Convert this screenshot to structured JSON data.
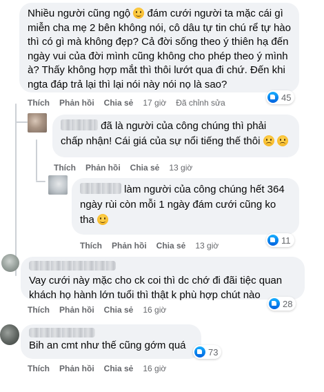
{
  "comments": [
    {
      "text_parts": [
        "Nhiều người cũng ngộ ",
        " đám cưới người ta mặc cái gì miễn cha mẹ 2 bên không nói, cô dâu tự tin chú rể tự hào thì có gì mà không đẹp? Cả đời sống theo ý thiên hạ đến ngày vui của đời mình cũng không cho phép theo ý mình à? Thấy không hợp mắt thì thôi lướt qua đi chứ. Đến khi ngta đáp trả lại thì lại nói này nói nọ là sao?"
      ],
      "actions": {
        "like": "Thích",
        "reply": "Phản hồi",
        "share": "Chia sẻ",
        "time": "17 giờ",
        "edited": "Đã chỉnh sửa"
      },
      "reaction_count": "45"
    },
    {
      "text_parts": [
        " đã là người của công chúng thì phải chấp nhận! Cái giá của sự nổi tiếng thế thôi "
      ],
      "actions": {
        "like": "Thích",
        "reply": "Phản hồi",
        "share": "Chia sẻ",
        "time": "13 giờ"
      }
    },
    {
      "text_parts": [
        " làm người của công chúng hết 364 ngày rùi còn mỗi 1 ngày đám cưới cũng ko tha "
      ],
      "actions": {
        "like": "Thích",
        "reply": "Phản hồi",
        "share": "Chia sẻ",
        "time": "13 giờ"
      },
      "reaction_count": "11"
    },
    {
      "text": "Vay cưới này mặc cho ck coi thì dc chớ đi đãi tiệc quan khách họ hành lớn tuổi thì thật k phù hợp chút nào",
      "actions": {
        "like": "Thích",
        "reply": "Phản hồi",
        "share": "Chia sẻ",
        "time": "16 giờ"
      },
      "reaction_count": "28"
    },
    {
      "text": "Bih an cmt như thế cũng gớm quá",
      "actions": {
        "like": "Thích",
        "reply": "Phản hồi",
        "share": "Chia sẻ",
        "time": "16 giờ"
      },
      "reaction_count": "73"
    }
  ],
  "colors": {
    "bubble": "#f0f2f5",
    "meta": "#65676b",
    "like_blue": "#0866ff"
  }
}
